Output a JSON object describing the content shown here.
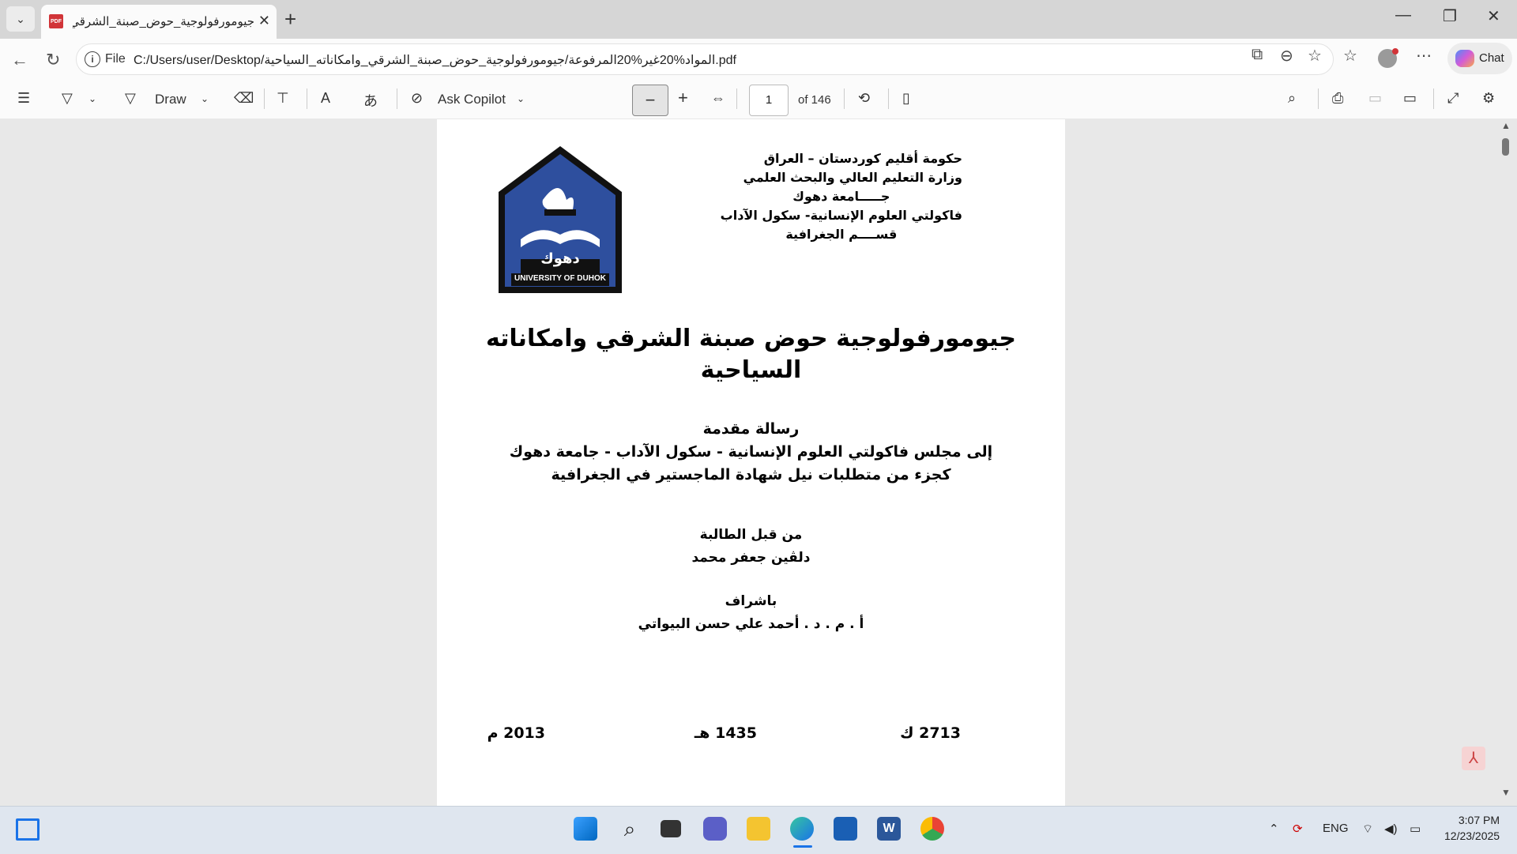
{
  "browser": {
    "tab_title": "جيومورفولوجية_حوض_صبنة_الشرقي",
    "url_scheme": "File",
    "url": "C:/Users/user/Desktop/المواد%20غير%20المرفوعة/جيومورفولوجية_حوض_صبنة_الشرقي_وامكاناته_السياحية.pdf",
    "chat_label": "Chat"
  },
  "pdf_toolbar": {
    "draw_label": "Draw",
    "ask_copilot_label": "Ask Copilot",
    "page_number": "1",
    "page_count": "of 146"
  },
  "document": {
    "header_lines": [
      "حكومة أقليم كوردستان – العراق",
      "وزارة التعليم العالي والبحث العلمي",
      "جـــــامعة دهوك",
      "فاكولتي العلوم الإنسانية- سكول الآداب",
      "قســــم الجغرافية"
    ],
    "logo_text": "UNIVERSITY OF DUHOK",
    "logo_word": "دهوك",
    "title_line1": "جيومورفولوجية حوض صبنة الشرقي وامكاناته",
    "title_line2": "السياحية",
    "thesis_lines": [
      "رسالة مقدمة",
      "إلى مجلس فاكولتي العلوم الإنسانية - سكول الآداب - جامعة دهوك",
      "كجزء من متطلبات نيل شهادة الماجستير في الجغرافية"
    ],
    "author_label": "من قبل الطالبة",
    "author_name": "دلڤين جعفر محمد",
    "supervisor_label": "باشراف",
    "supervisor_name": "أ . م . د . أحمد علي حسن البيواتي",
    "date_kurdish": "2713 ك",
    "date_hijri": "1435 هـ",
    "date_gregorian": "2013 م"
  },
  "taskbar": {
    "language": "ENG",
    "time": "3:07 PM",
    "date": "12/23/2025"
  }
}
